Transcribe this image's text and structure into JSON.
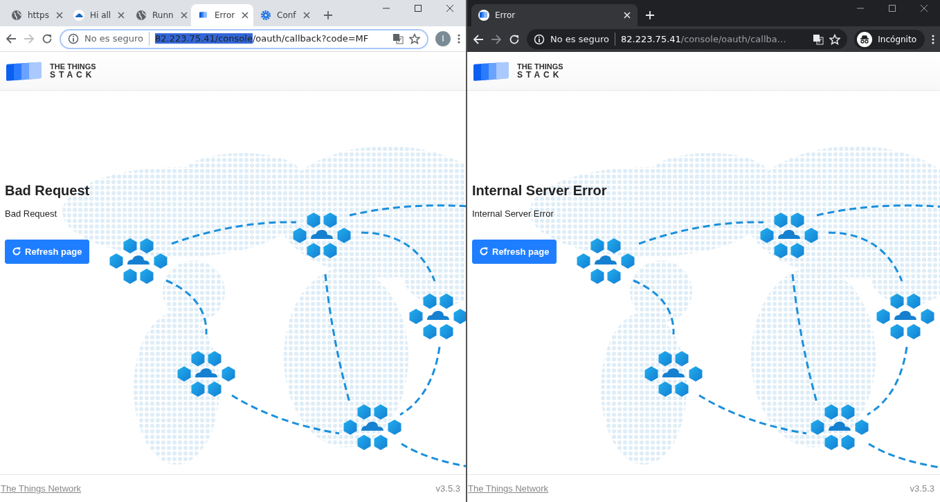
{
  "windows": [
    {
      "kind": "normal",
      "tabs": [
        {
          "kind": "globe",
          "title": "https",
          "selected": false
        },
        {
          "kind": "cloud",
          "title": "Hi all",
          "selected": false
        },
        {
          "kind": "globe",
          "title": "Runn",
          "selected": false
        },
        {
          "kind": "stack",
          "title": "Error",
          "selected": true
        },
        {
          "kind": "gear",
          "title": "Conf",
          "selected": false
        }
      ],
      "address": {
        "security": "No es seguro",
        "host": "82.223.75.41/console",
        "path": "/oauth/callback?code=MF",
        "host_highlighted": true
      },
      "profile": {
        "kind": "avatar",
        "label": "I"
      },
      "page": {
        "brand_top": "THE THINGS",
        "brand_bottom": "STACK",
        "heading": "Bad Request",
        "message": "Bad Request",
        "button": "Refresh page",
        "footer_link": "The Things Network",
        "version": "v3.5.3"
      }
    },
    {
      "kind": "incognito",
      "tabs": [
        {
          "kind": "stack",
          "title": "Error",
          "selected": true
        }
      ],
      "address": {
        "security": "No es seguro",
        "host": "82.223.75.41",
        "path": "/console/oauth/callba…",
        "host_highlighted": false
      },
      "profile": {
        "kind": "incognito",
        "label": "Incógnito"
      },
      "page": {
        "brand_top": "THE THINGS",
        "brand_bottom": "STACK",
        "heading": "Internal Server Error",
        "message": "Internal Server Error",
        "button": "Refresh page",
        "footer_link": "The Things Network",
        "version": "v3.5.3"
      }
    }
  ]
}
